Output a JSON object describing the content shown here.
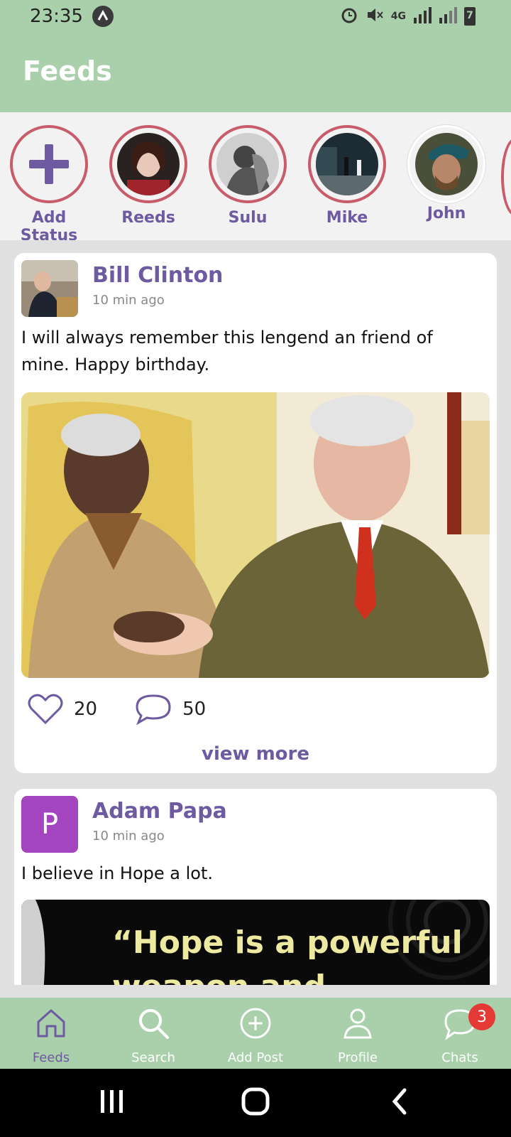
{
  "status_bar": {
    "time": "23:35",
    "network": "4G",
    "battery": "7"
  },
  "app_bar": {
    "title": "Feeds"
  },
  "stories": [
    {
      "label": "Add Status"
    },
    {
      "label": "Reeds"
    },
    {
      "label": "Sulu"
    },
    {
      "label": "Mike"
    },
    {
      "label": "John"
    }
  ],
  "posts": [
    {
      "author": "Bill Clinton",
      "time": "10 min ago",
      "text": "I will always remember this lengend an friend of mine. Happy birthday.",
      "likes": "20",
      "comments": "50",
      "view_more": "view more"
    },
    {
      "author": "Adam Papa",
      "avatar_letter": "P",
      "time": "10 min ago",
      "text": "I believe in Hope a lot.",
      "image_text": "“Hope is a powerful weapon and"
    }
  ],
  "bottom_nav": [
    {
      "label": "Feeds",
      "icon": "home-icon"
    },
    {
      "label": "Search",
      "icon": "search-icon"
    },
    {
      "label": "Add Post",
      "icon": "add-circle-icon"
    },
    {
      "label": "Profile",
      "icon": "person-icon"
    },
    {
      "label": "Chats",
      "icon": "chat-icon",
      "badge": "3"
    }
  ],
  "colors": {
    "accent": "#a9d0aa",
    "primary": "#6d5aa0",
    "story_ring": "#c85c6b",
    "badge": "#e53935",
    "avatar_p": "#a445c0"
  }
}
